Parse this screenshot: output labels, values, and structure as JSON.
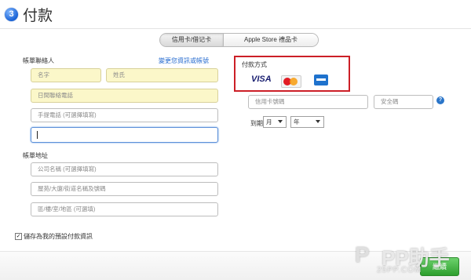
{
  "header": {
    "step_number": "3",
    "title": "付款"
  },
  "tabs": [
    {
      "label": "信用卡/借记卡",
      "active": true
    },
    {
      "label": "Apple Store 禮品卡",
      "active": false
    }
  ],
  "billing_contact": {
    "label": "帳單聯絡人",
    "edit_link": "變更您資訊或帳號",
    "fields": {
      "first_name": "名字",
      "last_name": "姓氏",
      "daytime_phone": "日間聯絡電話",
      "mobile_phone": "手提電話 (可選擇填寫)",
      "active_field_value": ""
    }
  },
  "billing_address": {
    "label": "帳單地址",
    "fields": {
      "company": "公司名稱 (可選擇填寫)",
      "street": "屋苑/大廈/街道名稱及號碼",
      "district": "區/樓/室/地區 (可選填)"
    }
  },
  "payment": {
    "title": "付款方式",
    "cards": [
      "VISA",
      "MasterCard",
      "American Express"
    ],
    "card_number_placeholder": "信用卡號碼",
    "security_code_placeholder": "安全碼",
    "expiry_label": "到期",
    "month_value": "月",
    "year_value": "年"
  },
  "save_default": {
    "checked": true,
    "label": "儲存為我的預設付款資訊"
  },
  "footer": {
    "continue_label": "繼續"
  },
  "watermark": {
    "logo": "P",
    "text": "PP助手",
    "url": "25PP.COM"
  },
  "colors": {
    "highlight_border": "#cc1f27",
    "link": "#2a6ed0",
    "continue": "#2d9e2d",
    "required_field": "#fbf7c9"
  }
}
